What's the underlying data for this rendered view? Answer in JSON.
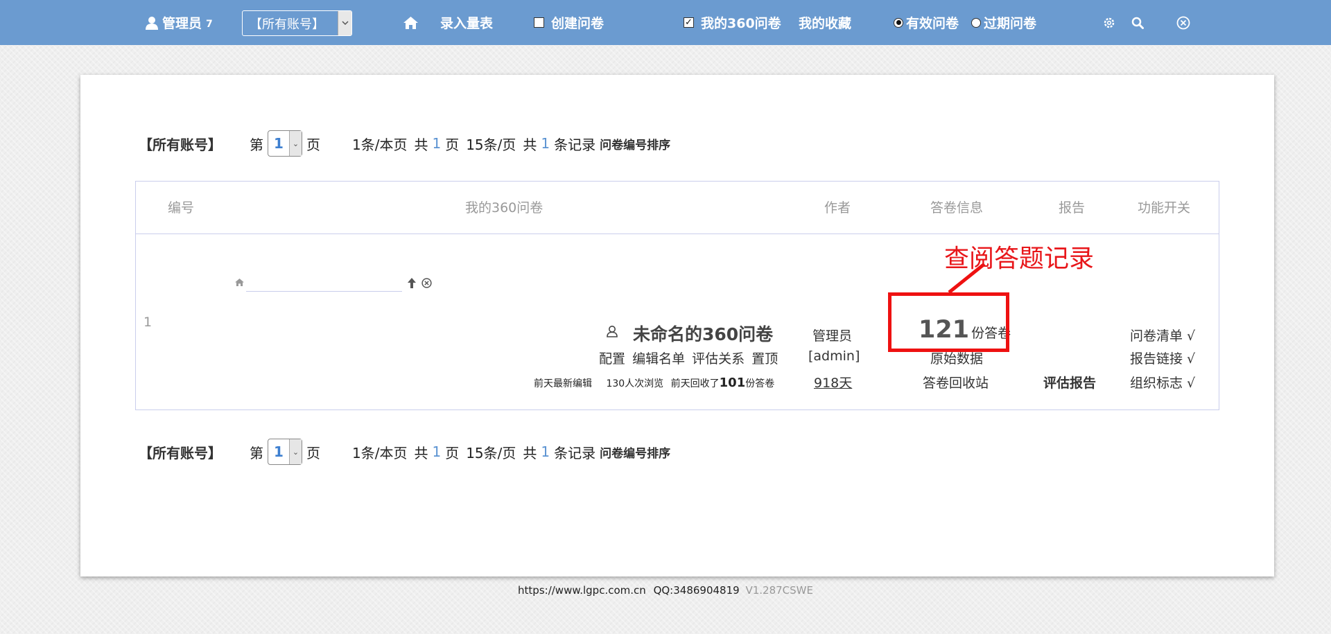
{
  "topbar": {
    "user_label": "管理员",
    "user_count": "7",
    "account_select": "【所有账号】",
    "nav_scale": "录入量表",
    "create_survey": "创建问卷",
    "my_360": "我的360问卷",
    "my_favorites": "我的收藏",
    "valid_survey": "有效问卷",
    "expired_survey": "过期问卷",
    "my_360_checked": true,
    "create_checked": false
  },
  "pager_top": {
    "account": "【所有账号】",
    "page_prefix": "第",
    "page_value": "1",
    "page_suffix": "页",
    "per_page_text": "1条/本页",
    "total_prefix": "共",
    "total_pages": "1",
    "total_pages_suffix": "页",
    "page_size": "15条/页",
    "total_records_prefix": "共",
    "total_records": "1",
    "total_records_suffix": "条记录",
    "sort_label": "问卷编号排序"
  },
  "pager_bottom": {
    "account": "【所有账号】",
    "page_prefix": "第",
    "page_value": "1",
    "page_suffix": "页",
    "per_page_text": "1条/本页",
    "total_prefix": "共",
    "total_pages": "1",
    "total_pages_suffix": "页",
    "page_size": "15条/页",
    "total_records_prefix": "共",
    "total_records": "1",
    "total_records_suffix": "条记录",
    "sort_label": "问卷编号排序"
  },
  "table": {
    "headers": {
      "id": "编号",
      "survey": "我的360问卷",
      "author": "作者",
      "answer_info": "答卷信息",
      "report": "报告",
      "switches": "功能开关"
    },
    "row": {
      "id": "1",
      "title": "未命名的360问卷",
      "actions": {
        "config": "配置",
        "edit_list": "编辑名单",
        "relations": "评估关系",
        "pin": "置顶"
      },
      "recent_edit": "前天最新编辑",
      "views": "130人次浏览",
      "recovered_prefix": "前天回收了",
      "recovered_count": "101",
      "recovered_suffix": "份答卷",
      "author_name": "管理员",
      "author_account": "[admin]",
      "days": "918天",
      "answer_count": "121",
      "answer_unit": "份答卷",
      "raw_data": "原始数据",
      "recycle_bin": "答卷回收站",
      "eval_report": "评估报告",
      "switch_list": "问卷清单 √",
      "switch_report_link": "报告链接 √",
      "switch_org_logo": "组织标志 √"
    }
  },
  "annotation": {
    "text": "查阅答题记录",
    "color": "#ee1111"
  },
  "footer": {
    "url": "https://www.lgpc.com.cn",
    "qq": "QQ:3486904819",
    "version": "V1.287CSWE"
  },
  "colors": {
    "topbar": "#6b9bd0",
    "accent_blue": "#5b93d2",
    "table_border": "#c9cdec"
  }
}
